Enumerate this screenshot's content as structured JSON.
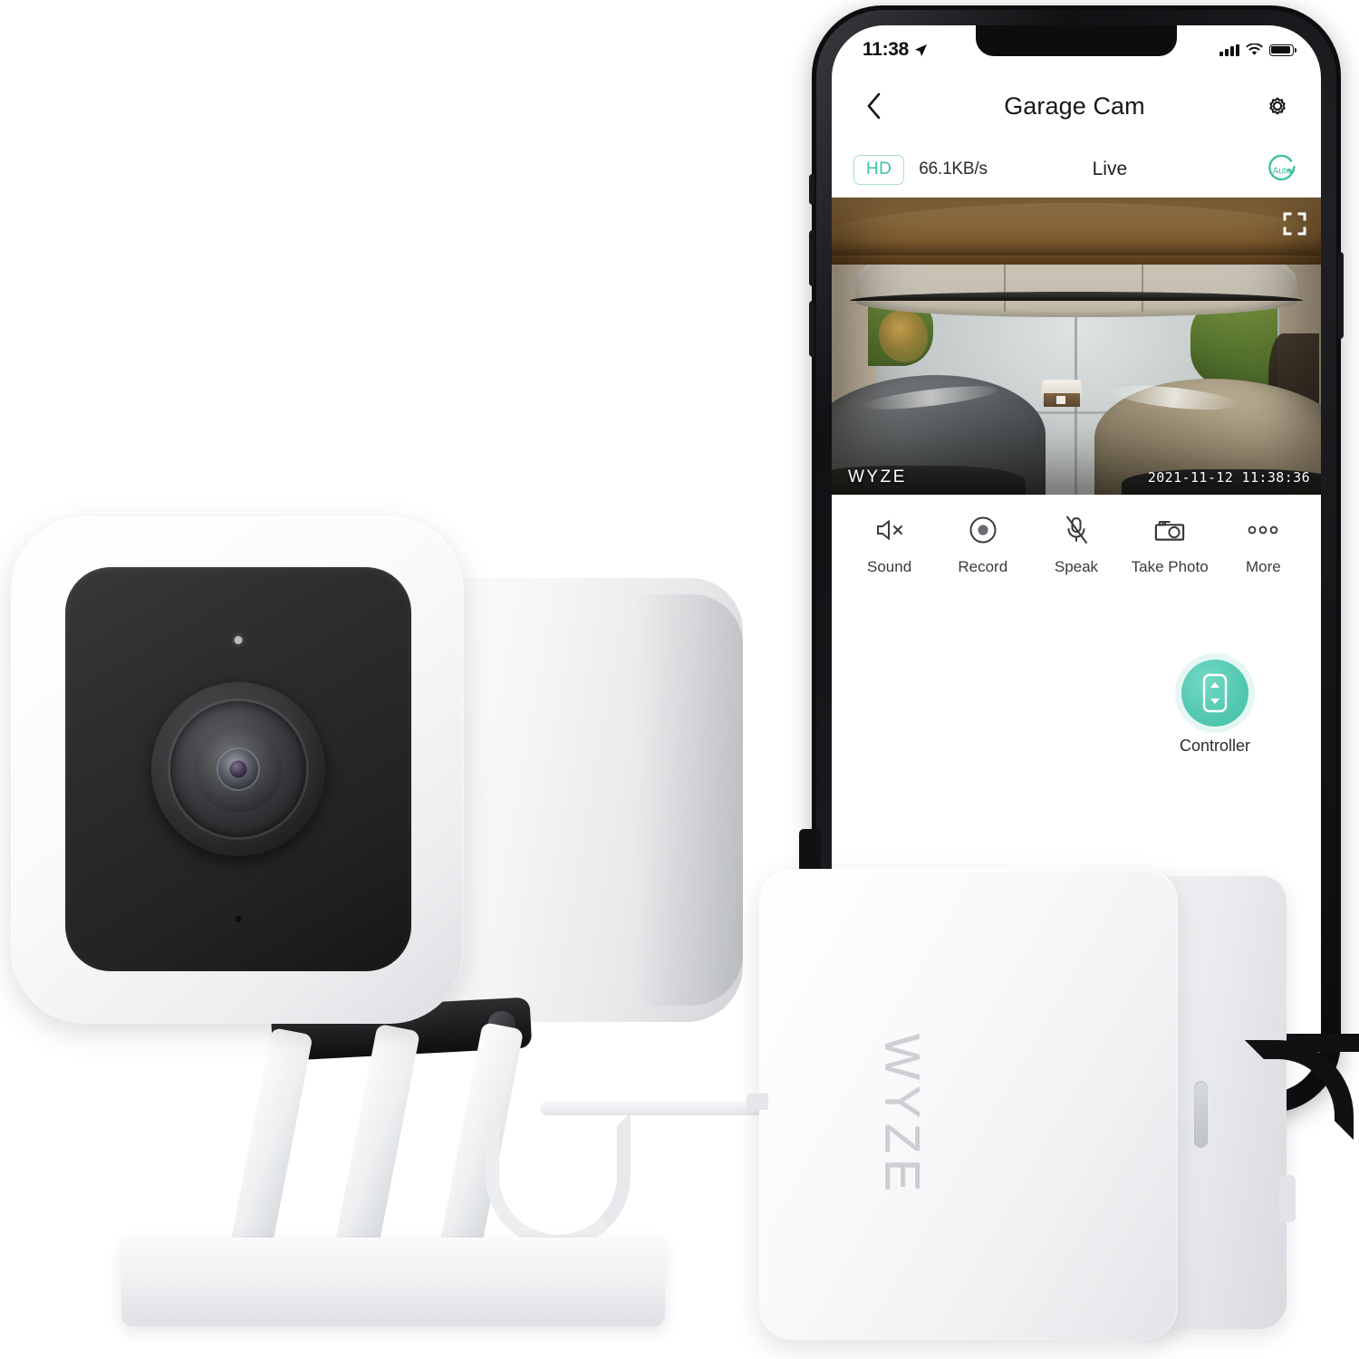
{
  "scene": {
    "description": "Wyze Cam v3 security camera with garage door controller and iPhone showing the Wyze app live view"
  },
  "phone": {
    "status_bar": {
      "time": "11:38",
      "location_icon": "location-arrow-icon",
      "signal_icon": "cellular-signal-icon",
      "wifi_icon": "wifi-icon",
      "battery_icon": "battery-full-icon"
    },
    "nav_bar": {
      "back_icon": "chevron-left-icon",
      "title": "Garage Cam",
      "settings_icon": "gear-icon"
    },
    "quality_bar": {
      "hd_label": "HD",
      "bitrate": "66.1KB/s",
      "status": "Live",
      "auto_label": "Auto",
      "auto_icon": "auto-refresh-icon"
    },
    "video": {
      "watermark": "WYZE",
      "timestamp": "2021-11-12  11:38:36",
      "fullscreen_icon": "fullscreen-expand-icon"
    },
    "actions": [
      {
        "label": "Sound",
        "icon": "speaker-muted-icon"
      },
      {
        "label": "Record",
        "icon": "record-circle-icon"
      },
      {
        "label": "Speak",
        "icon": "microphone-muted-icon"
      },
      {
        "label": "Take Photo",
        "icon": "camera-icon"
      },
      {
        "label": "More",
        "icon": "more-dots-icon"
      }
    ],
    "controller": {
      "label": "Controller",
      "icon": "remote-control-icon"
    }
  },
  "devices": {
    "camera": {
      "name": "wyze-cam-v3",
      "lens_icon": "camera-lens-icon"
    },
    "controller_box": {
      "name": "garage-door-controller",
      "brand": "WYZE"
    }
  },
  "colors": {
    "accent_teal": "#4dc4aa",
    "hd_border": "#a7ded3",
    "text_primary": "#17171a",
    "text_secondary": "#3a3a3e",
    "phone_frame": "#0d0d0f"
  }
}
